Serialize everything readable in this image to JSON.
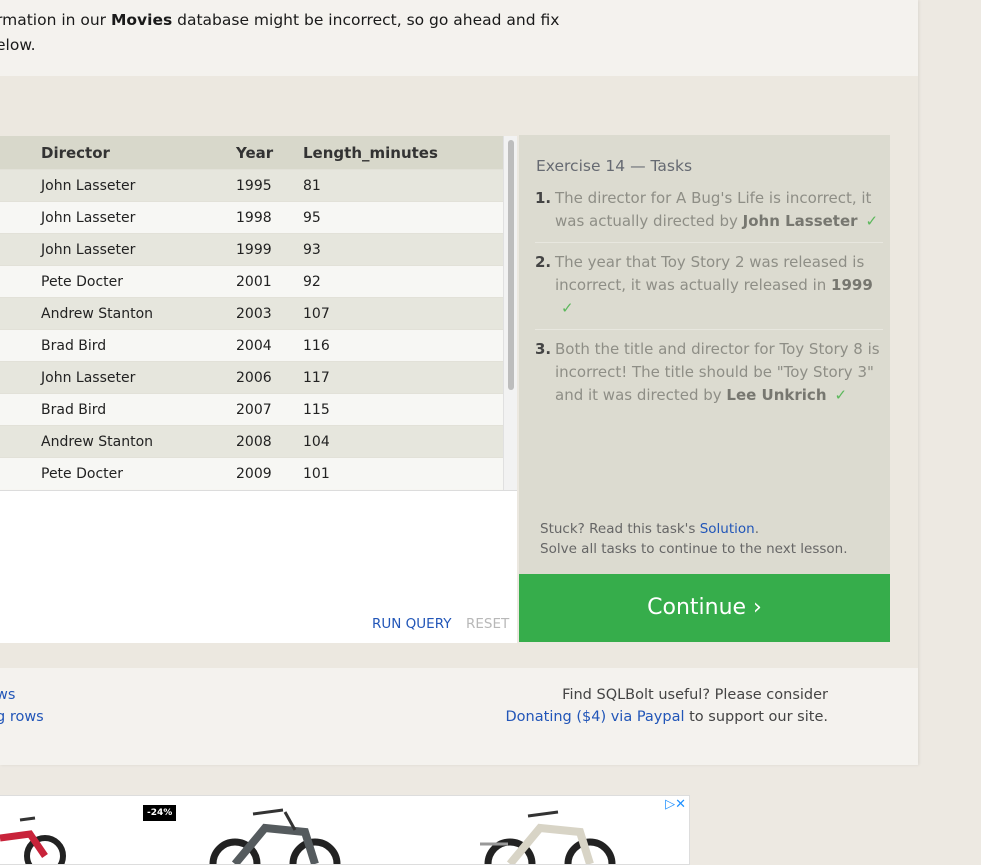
{
  "intro": {
    "line1_pre": "rmation in our ",
    "line1_bold": "Movies",
    "line1_post": " database might be incorrect, so go ahead and fix",
    "line2": "elow."
  },
  "table": {
    "headers": [
      "",
      "Director",
      "Year",
      "Length_minutes"
    ],
    "rows": [
      [
        "John Lasseter",
        "1995",
        "81"
      ],
      [
        "John Lasseter",
        "1998",
        "95"
      ],
      [
        "John Lasseter",
        "1999",
        "93"
      ],
      [
        "Pete Docter",
        "2001",
        "92"
      ],
      [
        "Andrew Stanton",
        "2003",
        "107"
      ],
      [
        "Brad Bird",
        "2004",
        "116"
      ],
      [
        "John Lasseter",
        "2006",
        "117"
      ],
      [
        "Brad Bird",
        "2007",
        "115"
      ],
      [
        "Andrew Stanton",
        "2008",
        "104"
      ],
      [
        "Pete Docter",
        "2009",
        "101"
      ]
    ]
  },
  "editor": {
    "run_label": "RUN QUERY",
    "reset_label": "RESET"
  },
  "tasks": {
    "title": "Exercise 14 — Tasks",
    "items": [
      {
        "num": "1.",
        "text": "The director for A Bug's Life is incorrect, it was actually directed by ",
        "bold": "John Lasseter",
        "check": "✓"
      },
      {
        "num": "2.",
        "text": "The year that Toy Story 2 was released is incorrect, it was actually released in ",
        "bold": "1999",
        "check": "✓"
      },
      {
        "num": "3.",
        "text": "Both the title and director for Toy Story 8 is incorrect! The title should be \"Toy Story 3\" and it was directed by ",
        "bold": "Lee Unkrich",
        "check": "✓"
      }
    ],
    "stuck_pre": "Stuck? Read this task's ",
    "solution_link": "Solution",
    "stuck_post": ".",
    "stuck_line2": "Solve all tasks to continue to the next lesson."
  },
  "continue_label": "Continue ›",
  "footer": {
    "prev_link_1": "ws",
    "prev_link_2": "g rows",
    "support_line1": "Find SQLBolt useful? Please consider",
    "donate_link": "Donating ($4) via Paypal",
    "support_post": " to support our site."
  },
  "ad": {
    "badge": "-24%",
    "adchoice_icon": "▷✕"
  },
  "colors": {
    "accent": "#36ad4b",
    "link": "#2256b8",
    "header": "#d8d8cb"
  }
}
